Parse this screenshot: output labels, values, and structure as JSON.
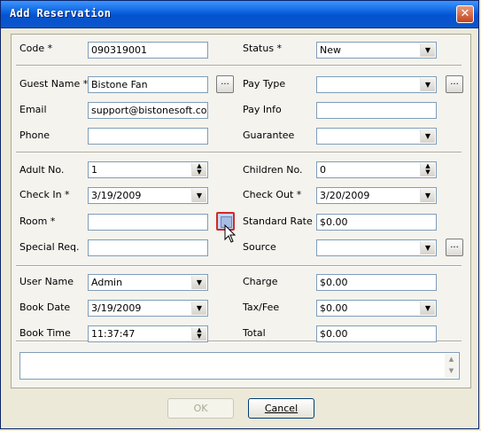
{
  "window": {
    "title": "Add Reservation",
    "close": "✕"
  },
  "labels": {
    "code": "Code *",
    "status": "Status *",
    "guest_name": "Guest Name *",
    "pay_type": "Pay Type",
    "email": "Email",
    "pay_info": "Pay Info",
    "phone": "Phone",
    "guarantee": "Guarantee",
    "adult_no": "Adult No.",
    "children_no": "Children No.",
    "check_in": "Check In *",
    "check_out": "Check Out *",
    "room": "Room *",
    "standard_rate": "Standard Rate",
    "special_req": "Special Req.",
    "source": "Source",
    "user_name": "User Name",
    "charge": "Charge",
    "book_date": "Book Date",
    "tax_fee": "Tax/Fee",
    "book_time": "Book Time",
    "total": "Total"
  },
  "values": {
    "code": "090319001",
    "status": "New",
    "guest_name": "Bistone Fan",
    "pay_type": "",
    "email": "support@bistonesoft.com",
    "pay_info": "",
    "phone": "",
    "guarantee": "",
    "adult_no": "1",
    "children_no": "0",
    "check_in": "3/19/2009",
    "check_out": "3/20/2009",
    "room": "",
    "standard_rate": "$0.00",
    "special_req": "",
    "source": "",
    "user_name": "Admin",
    "charge": "$0.00",
    "book_date": "3/19/2009",
    "tax_fee": "$0.00",
    "book_time": "11:37:47",
    "total": "$0.00",
    "notes": ""
  },
  "buttons": {
    "ellipsis": "...",
    "ok": "OK",
    "cancel": "Cancel"
  },
  "icons": {
    "dropdown": "chevron-down-icon",
    "spin_up": "spin-up-icon",
    "spin_down": "spin-down-icon",
    "room_picker": "room-picker-icon",
    "cursor": "mouse-pointer-icon"
  }
}
